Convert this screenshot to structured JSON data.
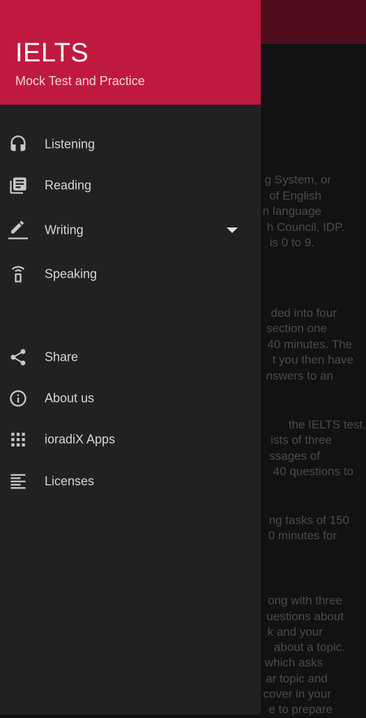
{
  "drawer": {
    "title": "IELTS",
    "subtitle": "Mock Test and Practice",
    "items": [
      {
        "label": "Listening",
        "icon": "headphones-icon"
      },
      {
        "label": "Reading",
        "icon": "library-books-icon"
      },
      {
        "label": "Writing",
        "icon": "edit-pen-icon"
      },
      {
        "label": "Speaking",
        "icon": "speaker-phone-icon"
      },
      {
        "label": "Share",
        "icon": "share-icon"
      },
      {
        "label": "About us",
        "icon": "info-icon"
      },
      {
        "label": "ioradiX Apps",
        "icon": "apps-grid-icon"
      },
      {
        "label": "Licenses",
        "icon": "text-lines-icon"
      }
    ]
  },
  "background": {
    "lines": [
      "g System, or",
      "of English",
      "n language",
      "h Council, IDP.",
      "is 0 to 9.",
      "ded into four",
      "section one",
      "40 minutes. The",
      "t you then have",
      "nswers to an",
      "the IELTS test,",
      "ists of three",
      "ssages of",
      "40 questions to",
      "ng tasks of 150",
      "0 minutes for",
      "ong with three",
      "uestions about",
      "k and your",
      "about a topic.",
      "which asks",
      "ar topic and",
      "cover in your",
      "e to prepare"
    ]
  },
  "colors": {
    "accent": "#c0193f",
    "drawer_bg": "#212121",
    "icon": "#c8c8c8"
  }
}
